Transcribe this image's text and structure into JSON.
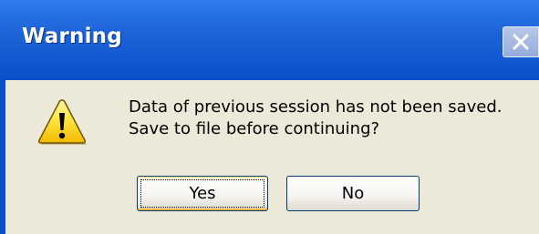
{
  "window": {
    "title": "Warning",
    "close_icon": "close-icon"
  },
  "dialog": {
    "icon": "warning-icon",
    "message_line1": "Data of previous session has not been saved.",
    "message_line2": "Save to file before continuing?"
  },
  "buttons": {
    "yes_label": "Yes",
    "no_label": "No"
  },
  "colors": {
    "titlebar": "#0b4fcb",
    "dialog_background": "#ece9d8",
    "button_border": "#003c74"
  }
}
